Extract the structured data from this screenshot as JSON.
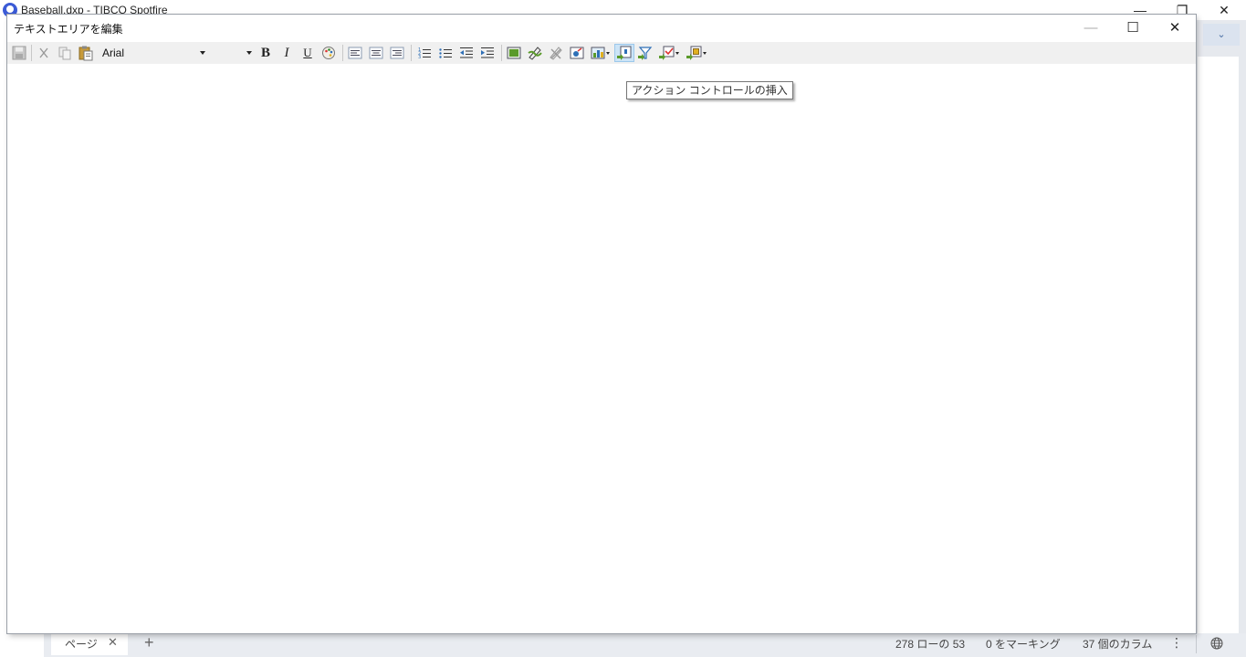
{
  "app": {
    "title": "Baseball.dxp - TIBCO Spotfire",
    "minimize_glyph": "—",
    "restore_glyph": "❐",
    "close_glyph": "✕",
    "dropdown_glyph": "⌄"
  },
  "dialog": {
    "title": "テキストエリアを編集",
    "minimize_glyph": "—",
    "maximize_glyph": "☐",
    "close_glyph": "✕"
  },
  "toolbar": {
    "font_name": "Arial",
    "font_size": "",
    "bold_label": "B",
    "italic_label": "I",
    "underline_label": "U",
    "icons": [
      "save-icon",
      "cut-icon",
      "copy-icon",
      "paste-icon",
      "bold-icon",
      "italic-icon",
      "underline-icon",
      "color-palette-icon",
      "align-left-icon",
      "align-center-icon",
      "align-right-icon",
      "numbered-list-icon",
      "bulleted-list-icon",
      "decrease-indent-icon",
      "increase-indent-icon",
      "insert-image-icon",
      "insert-property-control-icon",
      "remove-control-icon",
      "insert-dynamic-item-icon",
      "insert-visualization-icon",
      "insert-action-control-icon",
      "insert-filter-icon",
      "insert-check-control-icon",
      "insert-other-control-icon"
    ]
  },
  "tooltip": {
    "text": "アクション コントロールの挿入"
  },
  "statusbar": {
    "page_tab": "ページ",
    "page_close": "✕",
    "add_page": "+",
    "rows": "278 ローの 53",
    "marked": "0 をマーキング",
    "columns": "37 個のカラム",
    "more": "⋮"
  },
  "colors": {
    "accent": "#3b5bd6",
    "toolbar_bg": "#f0f0f0",
    "status_bg": "#e9ecf1",
    "icon_green": "#5a9a2a",
    "icon_blue": "#2f6fb6"
  }
}
